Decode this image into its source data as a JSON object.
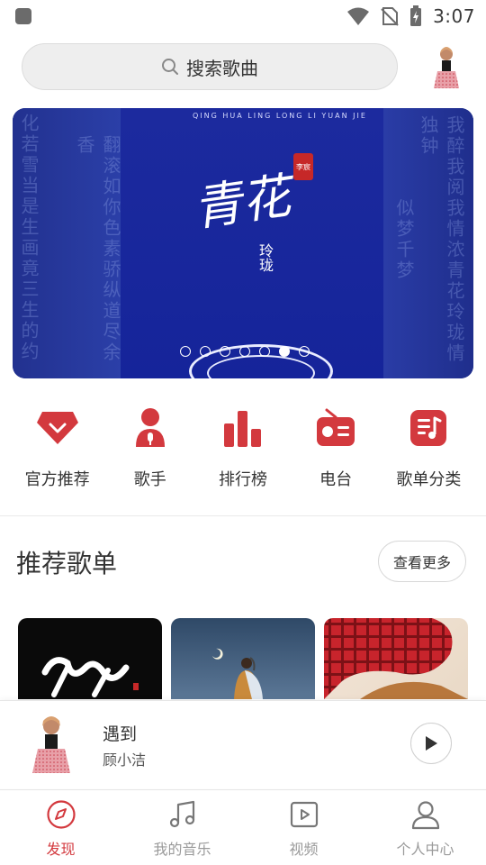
{
  "status_bar": {
    "time": "3:07"
  },
  "header": {
    "search_placeholder": "搜索歌曲"
  },
  "banner": {
    "pinyin": "QING HUA LING LONG LI YUAN JIE",
    "title": "青花",
    "subtitle": "玲珑",
    "seal": "李宸",
    "bg_text_left": [
      "化若雪当是生画竟三生的约",
      "翻滚如你色素骄纵道尽余香"
    ],
    "bg_text_right": [
      "我醉我阅我情浓青花玲珑情独钟",
      "似梦千梦"
    ],
    "page_count": 7,
    "active_index": 5
  },
  "categories": [
    {
      "label": "官方推荐",
      "icon": "diamond-icon"
    },
    {
      "label": "歌手",
      "icon": "singer-icon"
    },
    {
      "label": "排行榜",
      "icon": "bar-chart-icon"
    },
    {
      "label": "电台",
      "icon": "radio-icon"
    },
    {
      "label": "歌单分类",
      "icon": "playlist-icon"
    }
  ],
  "recommended": {
    "title": "推荐歌单",
    "more_label": "查看更多"
  },
  "player": {
    "song": "遇到",
    "artist": "顾小洁"
  },
  "nav": {
    "items": [
      {
        "label": "发现",
        "icon": "compass-icon",
        "active": true
      },
      {
        "label": "我的音乐",
        "icon": "music-note-icon",
        "active": false
      },
      {
        "label": "视频",
        "icon": "video-icon",
        "active": false
      },
      {
        "label": "个人中心",
        "icon": "person-icon",
        "active": false
      }
    ]
  },
  "colors": {
    "accent": "#d3393e",
    "banner_bg": "#1a2d8a"
  }
}
